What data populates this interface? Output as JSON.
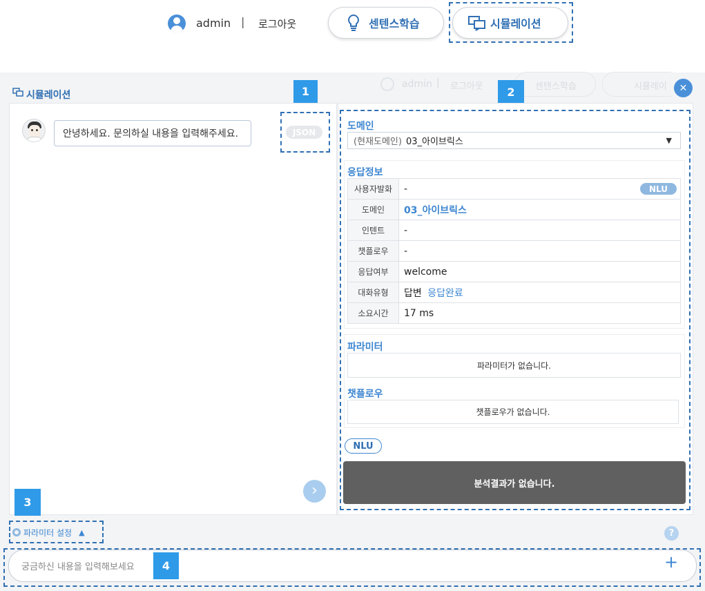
{
  "header": {
    "username": "admin",
    "separator": "|",
    "logout_label": "로그아웃",
    "sense_learning_label": "센텐스학습",
    "simulation_label": "시뮬레이션"
  },
  "simulation": {
    "title": "시뮬레이션",
    "ghost_header": {
      "username": "admin",
      "logout_label": "로그아웃",
      "sense_learning_label": "센텐스학습",
      "simulation_label": "시뮬레이"
    },
    "chat": {
      "greeting": "안녕하세요. 문의하실 내용을 입력해주세요.",
      "json_label": "JSON"
    },
    "domain": {
      "title": "도메인",
      "prefix": "(현재도메인)",
      "selected": "03_아이브릭스"
    },
    "response": {
      "title": "응답정보",
      "nlu_chip": "NLU",
      "rows": [
        {
          "key": "사용자발화",
          "value": "-"
        },
        {
          "key": "도메인",
          "value": "03_아이브릭스"
        },
        {
          "key": "인텐트",
          "value": "-"
        },
        {
          "key": "챗플로우",
          "value": "-"
        },
        {
          "key": "응답여부",
          "value": "welcome"
        },
        {
          "key": "대화유형",
          "value": "답변",
          "value_extra": "응답완료"
        },
        {
          "key": "소요시간",
          "value": "17 ms"
        }
      ]
    },
    "parameters": {
      "title": "파라미터",
      "empty": "파라미터가 없습니다."
    },
    "chatflow": {
      "title": "챗플로우",
      "empty": "챗플로우가 없습니다."
    },
    "nlu_button": "NLU",
    "analysis_empty": "분석결과가 없습니다.",
    "param_settings_label": "파라미터 설정",
    "input_placeholder": "궁금하신 내용을 입력해보세요",
    "plus_symbol": "+",
    "help_symbol": "?",
    "close_symbol": "✕",
    "next_symbol": "›",
    "caret_symbol": "▲",
    "dropdown_symbol": "▼"
  },
  "annotations": {
    "badge_1": "1",
    "badge_2": "2",
    "badge_3": "3",
    "badge_4": "4"
  },
  "colors": {
    "accent": "#2f6fb3",
    "badge": "#2f9ae8",
    "link": "#3d86d1",
    "dark_panel": "#606060"
  }
}
